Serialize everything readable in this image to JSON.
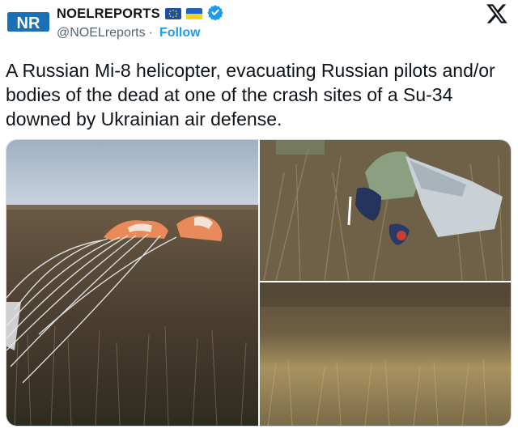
{
  "account": {
    "display_name": "NOELREPORTS",
    "logo_text": "NR",
    "handle": "@NOELreports",
    "separator": "·",
    "follow_label": "Follow"
  },
  "icons": {
    "flags": [
      "eu-flag-icon",
      "ukraine-flag-icon"
    ],
    "verified": "verified-badge-icon",
    "platform": "x-logo-icon"
  },
  "tweet": {
    "text": "A Russian Mi-8 helicopter, evacuating Russian pilots and/or bodies of the dead at one of the crash sites of a Su-34 downed by Ukrainian air defense."
  },
  "media": {
    "photos": [
      {
        "subject": "parachute-in-field"
      },
      {
        "subject": "ejection-seat-debris"
      },
      {
        "subject": "dry-grass-field"
      }
    ]
  },
  "colors": {
    "accent": "#1d9bf0",
    "text": "#0f1419",
    "secondary_text": "#536471",
    "brand_blue": "#1a6fb5"
  }
}
